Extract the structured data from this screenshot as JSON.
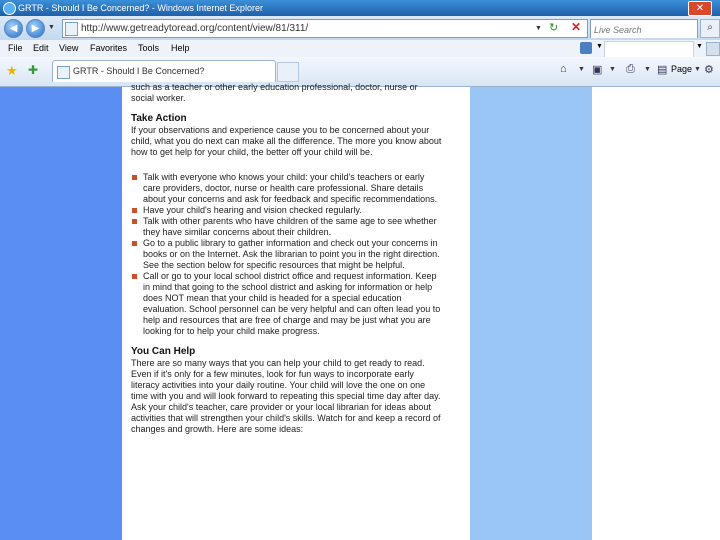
{
  "window": {
    "title": "GRTR - Should I Be Concerned? - Windows Internet Explorer",
    "close_glyph": "✕"
  },
  "address_bar": {
    "url": "http://www.getreadytoread.org/content/view/81/311/",
    "search_placeholder": "Live Search"
  },
  "menu": {
    "items": [
      "File",
      "Edit",
      "View",
      "Favorites",
      "Tools",
      "Help"
    ]
  },
  "tab": {
    "label": "GRTR - Should I Be Concerned?"
  },
  "command_bar": {
    "page_label": "Page"
  },
  "colors": {
    "left_band": "#5b8ef2",
    "right_band": "#99c6f5",
    "bullet": "#c8512a"
  },
  "article": {
    "intro_fragment": "such as a teacher or other early education professional, doctor, nurse or social worker.",
    "take_action": {
      "heading": "Take Action",
      "paragraph": "If your observations and experience cause you to be concerned about your child, what you do next can make all the difference. The more you know about how to get help for your child, the better off your child will be.",
      "bullets": [
        "Talk with everyone who knows your child: your child's teachers or early care providers, doctor, nurse or health care professional. Share details about your concerns and ask for feedback and specific recommendations.",
        "Have your child's hearing and vision checked regularly.",
        "Talk with other parents who have children of the same age to see whether they have similar concerns about their children.",
        "Go to a public library to gather information and check out your concerns in books or on the Internet. Ask the librarian to point you in the right direction. See the section below for specific resources that might be helpful.",
        "Call or go to your local school district office and request information. Keep in mind that going to the school district and asking for information or help does NOT mean that your child is headed for a special education evaluation. School personnel can be very helpful and can often lead you to help and resources that are free of charge and may be just what you are looking for to help your child make progress."
      ]
    },
    "you_can_help": {
      "heading": "You Can Help",
      "paragraph": "There are so many ways that you can help your child to get ready to read. Even if it's only for a few minutes, look for fun ways to incorporate early literacy activities into your daily routine. Your child will love the one on one time with you and will look forward to repeating this special time day after day. Ask your child's teacher, care provider or your local librarian for ideas about activities that will strengthen your child's skills. Watch for and keep a record of changes and growth. Here are some ideas:"
    }
  }
}
